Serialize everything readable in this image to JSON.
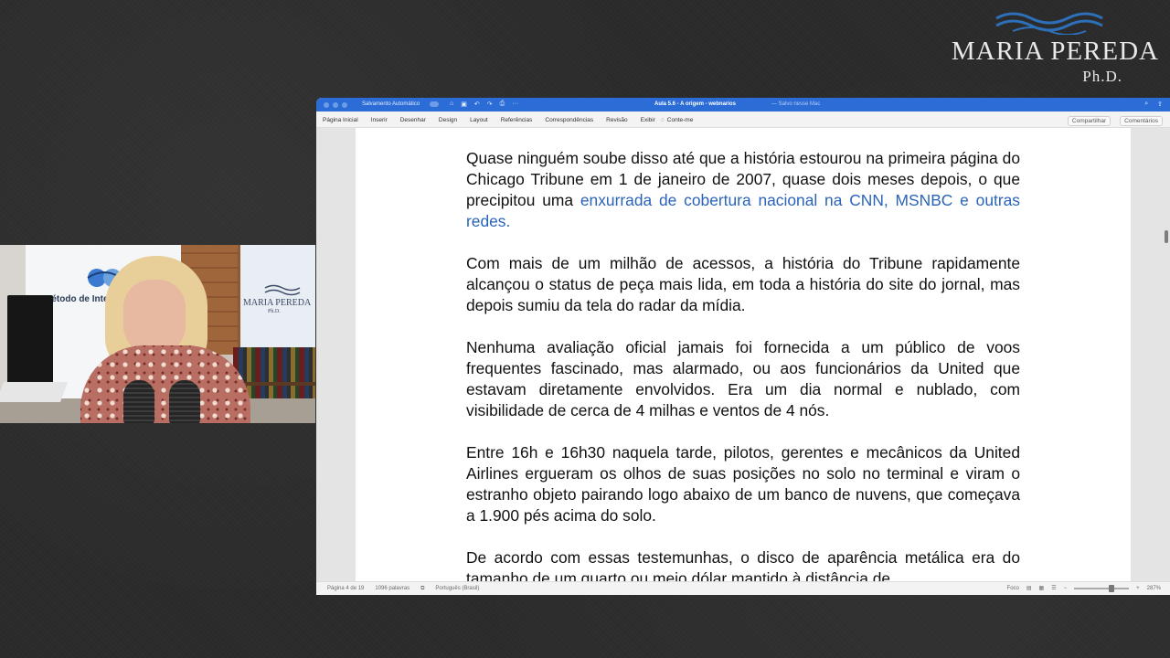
{
  "brand": {
    "name": "Maria Pereda",
    "degree": "Ph.D."
  },
  "webcam": {
    "panel_text": "Método de Integr",
    "poster_text": "Maria Pereda",
    "poster_sub": "Ph.D."
  },
  "word": {
    "titlebar": {
      "autosave_label": "Salvamento Automático",
      "doc_title": "Aula 5.6 - A origem - webnarios",
      "doc_status": "— Salvo nesse Mac"
    },
    "ribbon": {
      "tabs": [
        "Página Inicial",
        "Inserir",
        "Desenhar",
        "Design",
        "Layout",
        "Referências",
        "Correspondências",
        "Revisão",
        "Exibir"
      ],
      "tell_me": "Conte-me",
      "share": "Compartilhar",
      "comments": "Comentários"
    },
    "document": {
      "p1_text": "Quase ninguém soube disso até que a história estourou na primeira página do Chicago Tribune em 1 de janeiro de 2007, quase dois meses depois, o que precipitou uma ",
      "p1_link": "enxurrada de cobertura nacional na CNN, MSNBC e outras redes.",
      "p2": "Com mais de um milhão de acessos, a história do Tribune rapidamente alcançou o status de peça mais lida, em toda a história do site do jornal, mas depois sumiu da tela do radar da mídia.",
      "p3": "Nenhuma avaliação oficial jamais foi fornecida a um público de voos frequentes fascinado, mas alarmado, ou aos funcionários da United que estavam diretamente envolvidos. Era um dia normal e nublado, com visibilidade de cerca de 4 milhas e ventos de 4 nós.",
      "p4": "Entre 16h e 16h30 naquela tarde, pilotos, gerentes e mecânicos da United Airlines ergueram os olhos de suas posições no solo no terminal e viram o estranho objeto pairando logo abaixo de um banco de nuvens, que começava a 1.900 pés acima do solo.",
      "p5": "De acordo com essas testemunhas, o disco de aparência metálica era do tamanho de um quarto ou meio dólar mantido à distância de"
    },
    "statusbar": {
      "page": "Página 4 de 19",
      "words": "1096 palavras",
      "language": "Português (Brasil)",
      "focus": "Foco",
      "zoom": "287%"
    }
  },
  "icons": {
    "home": "home-icon",
    "save": "save-icon",
    "undo": "undo-icon",
    "redo": "redo-icon",
    "search": "search-icon",
    "share": "share-icon"
  }
}
